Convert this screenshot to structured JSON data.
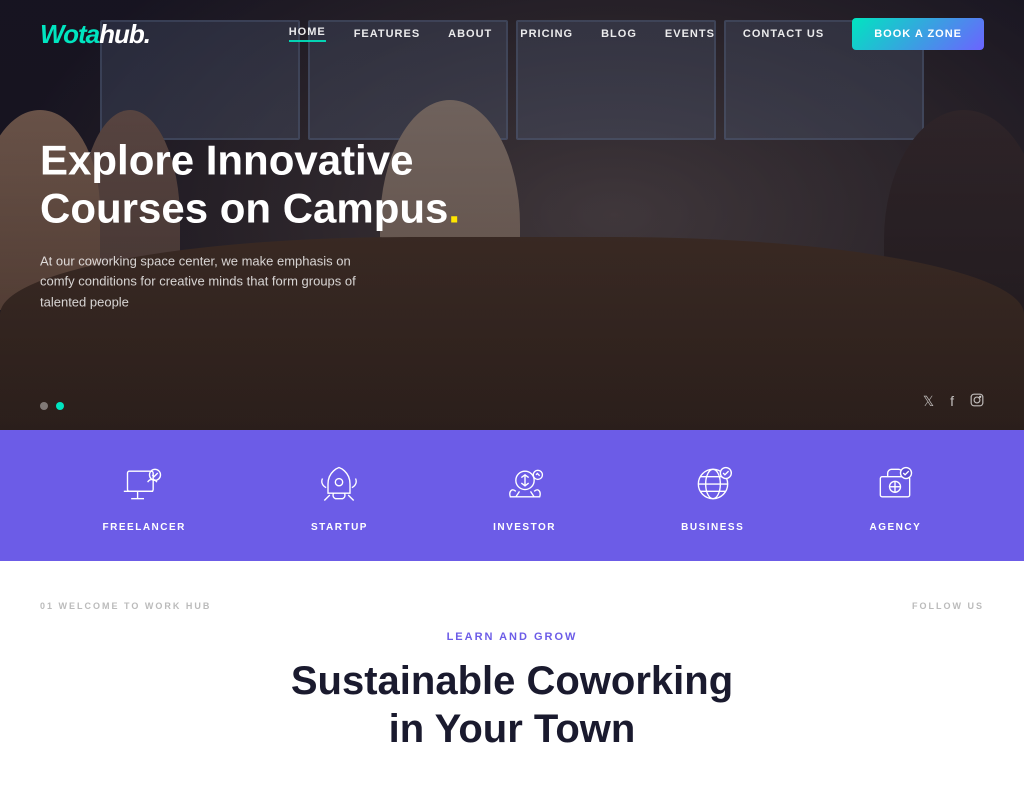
{
  "site": {
    "logo_wota": "Wota",
    "logo_hub": "hub.",
    "logo_dot": ""
  },
  "nav": {
    "items": [
      {
        "label": "HOME",
        "active": true
      },
      {
        "label": "FEATURES",
        "active": false
      },
      {
        "label": "ABOUT",
        "active": false
      },
      {
        "label": "PRICING",
        "active": false
      },
      {
        "label": "BLOG",
        "active": false
      },
      {
        "label": "EVENTS",
        "active": false
      },
      {
        "label": "CONTACT US",
        "active": false
      }
    ],
    "book_btn": "BOOK A ZONE"
  },
  "hero": {
    "title_line1": "Explore Innovative",
    "title_line2": "Courses on Campus",
    "title_dot": ".",
    "subtitle": "At our coworking space center, we make emphasis on comfy conditions for creative minds that form groups of talented people",
    "dots": [
      false,
      true
    ],
    "social": [
      "𝕏",
      "f",
      "◻"
    ]
  },
  "categories": [
    {
      "label": "FREELANCER",
      "icon": "freelancer"
    },
    {
      "label": "STARTUP",
      "icon": "startup"
    },
    {
      "label": "INVESTOR",
      "icon": "investor"
    },
    {
      "label": "BUSINESS",
      "icon": "business"
    },
    {
      "label": "AGENCY",
      "icon": "agency"
    }
  ],
  "below": {
    "left_label": "01 WELCOME TO WORK HUB",
    "right_label": "FOLLOW US"
  },
  "main": {
    "eyebrow": "LEARN AND GROW",
    "heading_line1": "Sustainable Coworking",
    "heading_line2": "in Your Town"
  }
}
